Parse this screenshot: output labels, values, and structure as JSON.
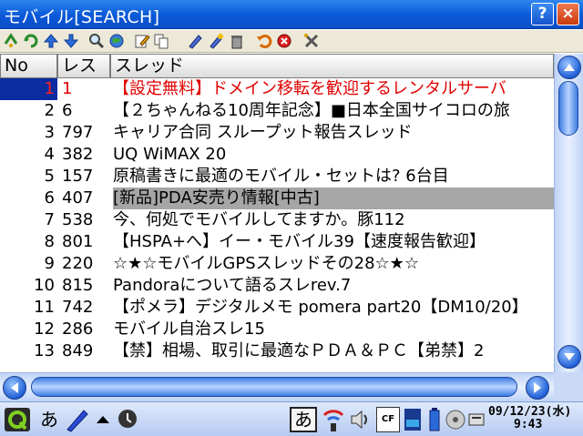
{
  "window": {
    "title": "モバイル[SEARCH]",
    "help_label": "?",
    "close_label": "×"
  },
  "columns": {
    "no": "No",
    "res": "レス",
    "thread": "スレッド"
  },
  "rows": [
    {
      "no": "1",
      "res": "1",
      "title": "【設定無料】ドメイン移転を歓迎するレンタルサーバ",
      "red": true,
      "selected_no": true
    },
    {
      "no": "2",
      "res": "6",
      "title": "【２ちゃんねる10周年記念】■日本全国サイコロの旅"
    },
    {
      "no": "3",
      "res": "797",
      "title": "キャリア合同 スループット報告スレッド"
    },
    {
      "no": "4",
      "res": "382",
      "title": "UQ WiMAX 20"
    },
    {
      "no": "5",
      "res": "157",
      "title": "原稿書きに最適のモバイル・セットは? 6台目"
    },
    {
      "no": "6",
      "res": "407",
      "title": "[新品]PDA安売り情報[中古]",
      "highlight": true
    },
    {
      "no": "7",
      "res": "538",
      "title": "今、何処でモバイルしてますか。豚112"
    },
    {
      "no": "8",
      "res": "801",
      "title": "【HSPA+へ】イー・モバイル39【速度報告歓迎】"
    },
    {
      "no": "9",
      "res": "220",
      "title": "☆★☆モバイルGPSスレッドその28☆★☆"
    },
    {
      "no": "10",
      "res": "815",
      "title": "Pandoraについて語るスレrev.7"
    },
    {
      "no": "11",
      "res": "742",
      "title": "【ポメラ】デジタルメモ pomera part20【DM10/20】"
    },
    {
      "no": "12",
      "res": "286",
      "title": "モバイル自治スレ15"
    },
    {
      "no": "13",
      "res": "849",
      "title": "【禁】相場、取引に最適なＰＤＡ＆ＰＣ【弟禁】2"
    }
  ],
  "taskbar": {
    "ime_mode": "あ",
    "ime_box": "あ",
    "cf_label": "CF",
    "date": "09/12/23(水)",
    "time": "9:43"
  },
  "colors": {
    "title_bar": "#0a58d8",
    "selection_bg": "#0a2ca0",
    "highlight_bg": "#a6a6a6",
    "red_text": "#e00000"
  }
}
